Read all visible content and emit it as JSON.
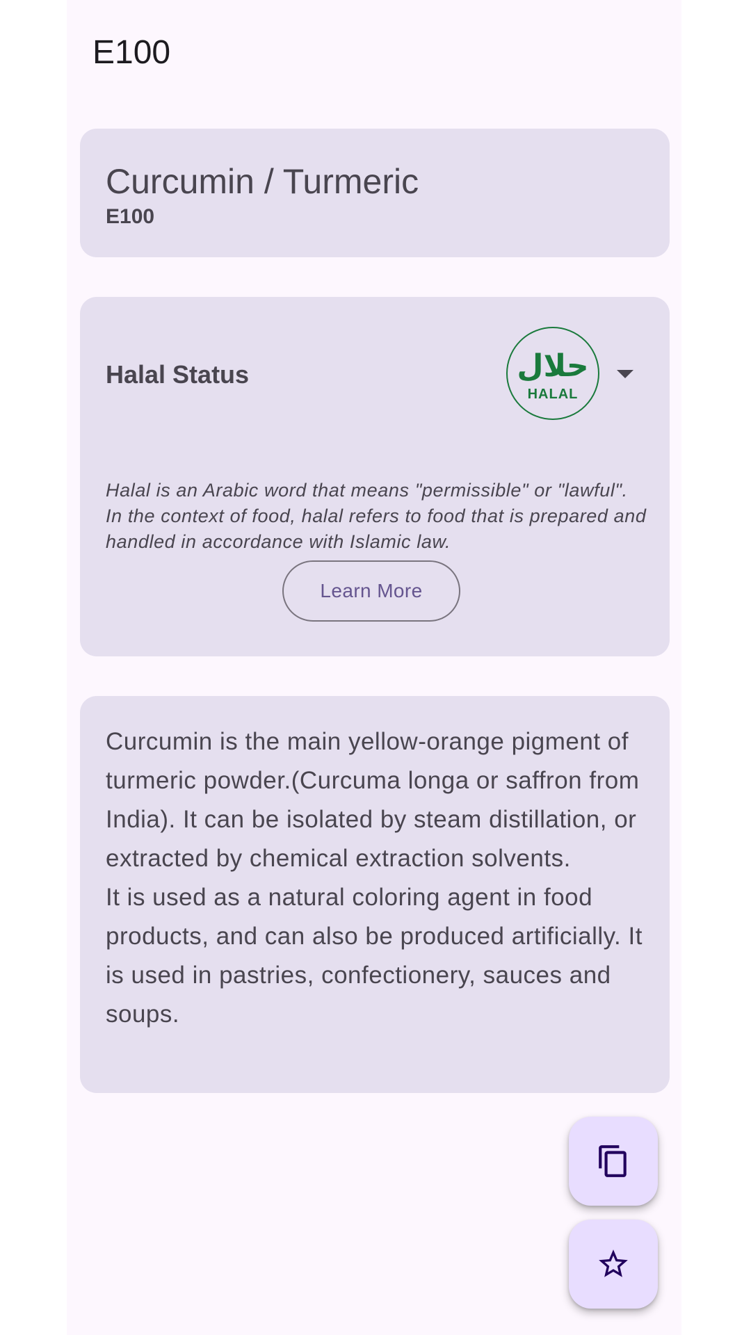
{
  "app_bar": {
    "title": "E100"
  },
  "additive": {
    "name": "Curcumin / Turmeric",
    "code": "E100"
  },
  "halal": {
    "title": "Halal Status",
    "logo_arabic": "حلال",
    "logo_text": "HALAL",
    "logo_color": "#1a7a3c",
    "description": "Halal is an Arabic word that means \"permissible\" or \"lawful\". In the context of food, halal refers to food that is prepared and handled in accordance with Islamic law.",
    "learn_more_label": "Learn More",
    "dropdown_icon": "arrow-drop-down-icon"
  },
  "description": {
    "text": "Curcumin is the main yellow-orange pigment of turmeric powder.(Curcuma longa or saffron from India). It can be isolated by steam distillation, or extracted by chemical extraction solvents.\n It is used as a natural coloring agent in food products, and can also be produced artificially. It is used in pastries, confectionery, sauces and soups."
  },
  "fabs": {
    "copy_icon": "copy-icon",
    "favorite_icon": "star-outline-icon"
  },
  "colors": {
    "background": "#fdf7fe",
    "card": "#e5dfef",
    "fab": "#e8ddff",
    "accent": "#65558f"
  }
}
